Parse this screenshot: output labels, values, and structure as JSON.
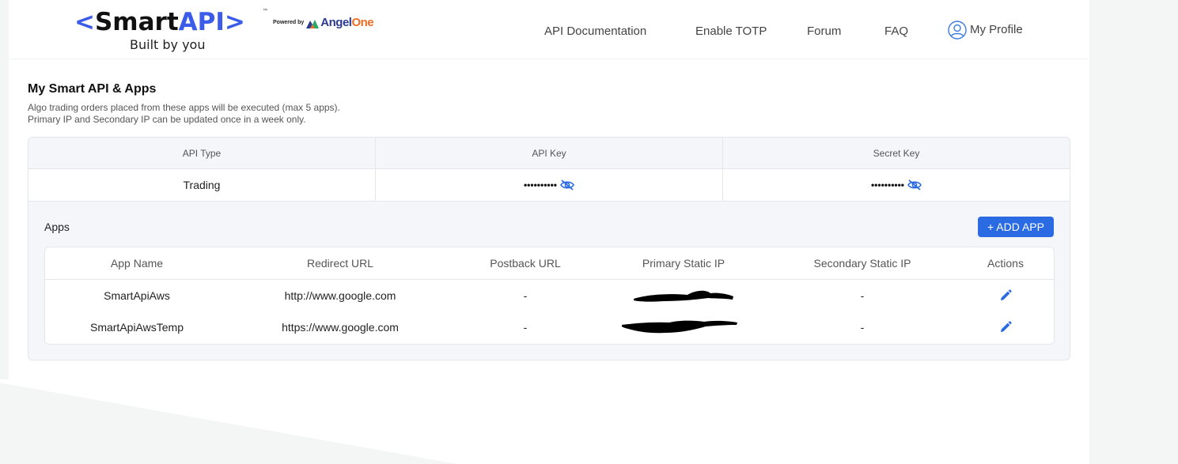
{
  "header": {
    "logo": {
      "prefix": "<",
      "smart": "Smart",
      "api": "API",
      "suffix": ">",
      "tm": "™",
      "tagline": "Built by you",
      "powered_by": "Powered by",
      "angel": "Angel",
      "one": "One"
    },
    "nav": {
      "api_documentation": "API Documentation",
      "enable_totp": "Enable TOTP",
      "forum": "Forum",
      "faq": "FAQ",
      "my_profile": "My Profile"
    }
  },
  "main": {
    "title": "My Smart API & Apps",
    "subtitle_1": "Algo trading orders placed from these apps will be executed (max 5 apps).",
    "subtitle_2": "Primary IP and Secondary IP can be updated once in a week only.",
    "keys_table": {
      "headers": [
        "API Type",
        "API Key",
        "Secret Key"
      ],
      "row": {
        "api_type": "Trading",
        "api_key_masked": "••••••••••",
        "secret_key_masked": "••••••••••"
      }
    },
    "apps": {
      "label": "Apps",
      "add_button": "+ ADD APP",
      "headers": [
        "App Name",
        "Redirect URL",
        "Postback URL",
        "Primary Static IP",
        "Secondary Static IP",
        "Actions"
      ],
      "rows": [
        {
          "app_name": "SmartApiAws",
          "redirect_url": "http://www.google.com",
          "postback_url": "-",
          "secondary_ip": "-"
        },
        {
          "app_name": "SmartApiAwsTemp",
          "redirect_url": "https://www.google.com",
          "postback_url": "-",
          "secondary_ip": "-"
        }
      ]
    }
  },
  "colors": {
    "brand_blue": "#3b5ce8",
    "button_blue": "#2a6ae3",
    "angel_orange": "#ef6c22"
  },
  "icons": [
    "profile-icon",
    "eye-off-icon",
    "edit-pencil-icon",
    "angelone-logo-icon"
  ]
}
